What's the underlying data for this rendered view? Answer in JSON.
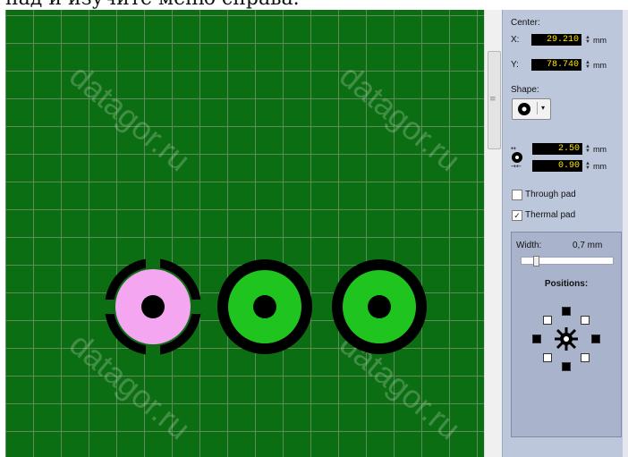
{
  "caption": "пад и изучите меню справа.",
  "watermark": "datagor.ru",
  "colors": {
    "board": "#0c6e12",
    "pad_copper": "#1fc41f",
    "pad_selected": "#f4a6f0",
    "clearance": "#000000",
    "panel_bg": "#bcc7dc",
    "value_fg": "#ffe600"
  },
  "panel": {
    "center_label": "Center:",
    "x_label": "X:",
    "x_value": "29.210",
    "y_label": "Y:",
    "y_value": "78.740",
    "unit": "mm",
    "shape_label": "Shape:",
    "shape_icon": "pad-round-icon",
    "outer_diameter": "2.50",
    "hole_diameter": "0.90",
    "through_pad_label": "Through pad",
    "through_pad_checked": false,
    "thermal_pad_label": "Thermal pad",
    "thermal_pad_checked": true,
    "width_label": "Width:",
    "width_value": "0,7 mm",
    "positions_label": "Positions:"
  },
  "pads": [
    {
      "kind": "thermal",
      "selected": true
    },
    {
      "kind": "plain",
      "selected": false
    },
    {
      "kind": "plain",
      "selected": false
    }
  ]
}
